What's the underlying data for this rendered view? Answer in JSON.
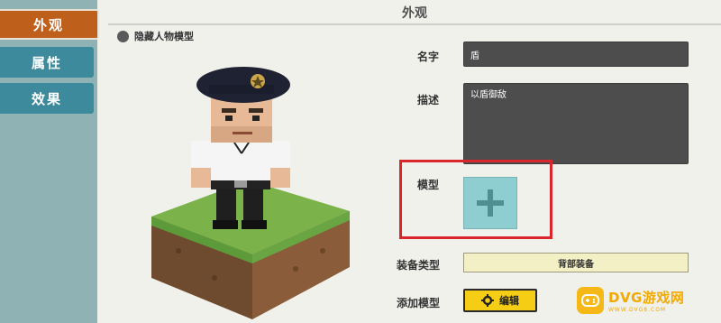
{
  "sidebar": {
    "tabs": [
      {
        "label": "外观",
        "active": true
      },
      {
        "label": "属性",
        "active": false
      },
      {
        "label": "效果",
        "active": false
      }
    ]
  },
  "header": {
    "title": "外观"
  },
  "preview": {
    "hide_model_label": "隐藏人物模型"
  },
  "form": {
    "name_label": "名字",
    "name_value": "盾",
    "desc_label": "描述",
    "desc_value": "以盾御敌",
    "model_label": "模型",
    "equip_type_label": "装备类型",
    "equip_type_value": "背部装备",
    "add_model_label": "添加模型",
    "edit_label": "编辑"
  },
  "watermark": {
    "main": "DVG游戏网",
    "sub": "WWW.DVG8.COM"
  },
  "colors": {
    "active_tab": "#bf5f1c",
    "inactive_tab": "#3c8a9c",
    "highlight_box": "#d9262c",
    "edit_button": "#f5cd14",
    "plus_button": "#8ecdd0"
  }
}
